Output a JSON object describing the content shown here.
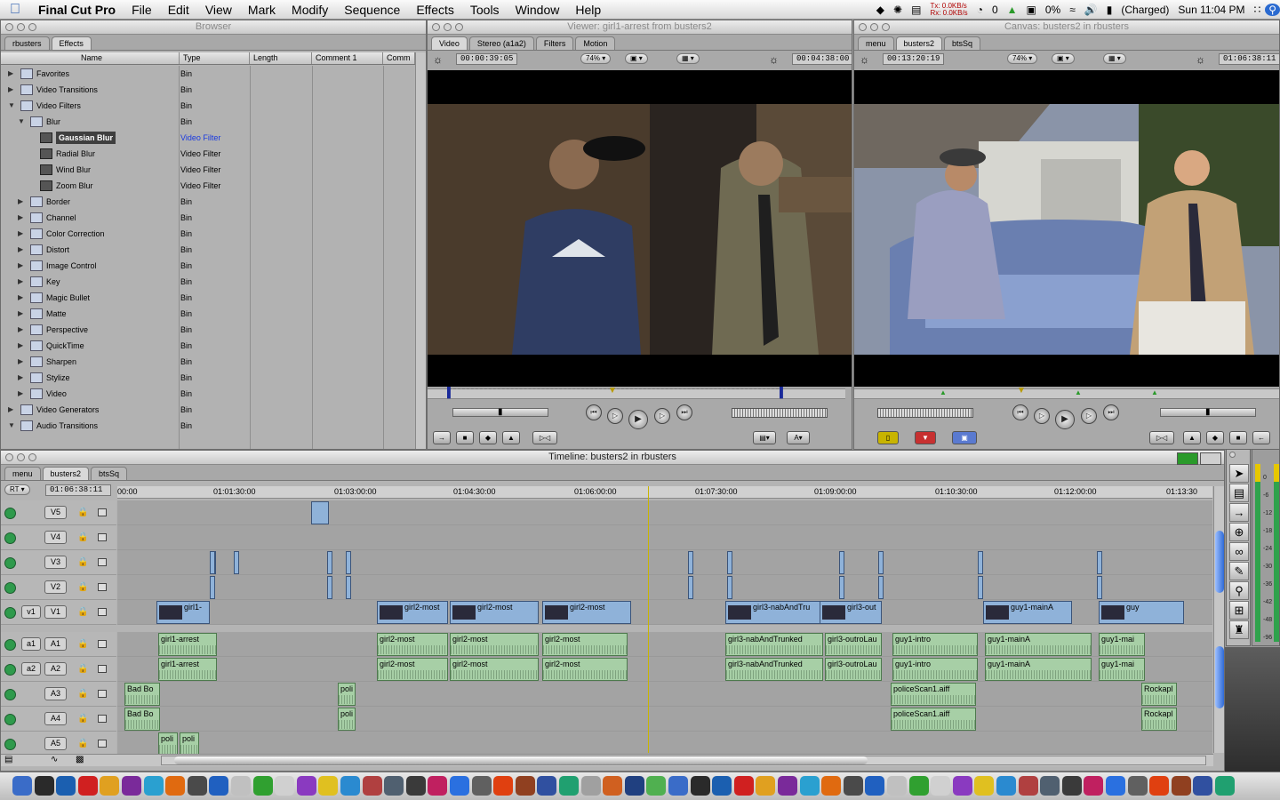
{
  "menubar": {
    "app_name": "Final Cut Pro",
    "items": [
      "File",
      "Edit",
      "View",
      "Mark",
      "Modify",
      "Sequence",
      "Effects",
      "Tools",
      "Window",
      "Help"
    ],
    "net_tx": "Tx: 0.0KB/s",
    "net_rx": "Rx: 0.0KB/s",
    "counter": "0",
    "cpu": "0%",
    "battery": "(Charged)",
    "clock": "Sun 11:04 PM"
  },
  "browser": {
    "title": "Browser",
    "tabs": [
      "rbusters",
      "Effects"
    ],
    "columns": [
      "Name",
      "Type",
      "Length",
      "Comment 1",
      "Comm"
    ],
    "rows": [
      {
        "name": "Favorites",
        "type": "Bin"
      },
      {
        "name": "Video Transitions",
        "type": "Bin"
      },
      {
        "name": "Video Filters",
        "type": "Bin"
      },
      {
        "name": "Blur",
        "type": "Bin"
      },
      {
        "name": "Gaussian Blur",
        "type": "Video Filter"
      },
      {
        "name": "Radial Blur",
        "type": "Video Filter"
      },
      {
        "name": "Wind Blur",
        "type": "Video Filter"
      },
      {
        "name": "Zoom Blur",
        "type": "Video Filter"
      },
      {
        "name": "Border",
        "type": "Bin"
      },
      {
        "name": "Channel",
        "type": "Bin"
      },
      {
        "name": "Color Correction",
        "type": "Bin"
      },
      {
        "name": "Distort",
        "type": "Bin"
      },
      {
        "name": "Image Control",
        "type": "Bin"
      },
      {
        "name": "Key",
        "type": "Bin"
      },
      {
        "name": "Magic Bullet",
        "type": "Bin"
      },
      {
        "name": "Matte",
        "type": "Bin"
      },
      {
        "name": "Perspective",
        "type": "Bin"
      },
      {
        "name": "QuickTime",
        "type": "Bin"
      },
      {
        "name": "Sharpen",
        "type": "Bin"
      },
      {
        "name": "Stylize",
        "type": "Bin"
      },
      {
        "name": "Video",
        "type": "Bin"
      },
      {
        "name": "Video Generators",
        "type": "Bin"
      },
      {
        "name": "Audio Transitions",
        "type": "Bin"
      }
    ]
  },
  "viewer": {
    "title": "Viewer: girl1-arrest from busters2",
    "tabs": [
      "Video",
      "Stereo (a1a2)",
      "Filters",
      "Motion"
    ],
    "timecode": "00:00:39:05",
    "zoom": "74%",
    "duration": "00:04:38:00"
  },
  "canvas": {
    "title": "Canvas: busters2 in rbusters",
    "tabs": [
      "menu",
      "busters2",
      "btsSq"
    ],
    "timecode": "00:13:20:19",
    "zoom": "74%",
    "duration": "01:06:38:11"
  },
  "timeline": {
    "title": "Timeline: busters2 in rbusters",
    "tabs": [
      "menu",
      "busters2",
      "btsSq"
    ],
    "rt": "RT",
    "current_tc": "01:06:38:11",
    "ruler": [
      "00:00",
      "01:01:30:00",
      "01:03:00:00",
      "01:04:30:00",
      "01:06:00:00",
      "01:07:30:00",
      "01:09:00:00",
      "01:10:30:00",
      "01:12:00:00",
      "01:13:30"
    ],
    "tracks": [
      "V5",
      "V4",
      "V3",
      "V2",
      "V1",
      "A1",
      "A2",
      "A3",
      "A4",
      "A5"
    ],
    "src_v": "v1",
    "src_a1": "a1",
    "src_a2": "a2",
    "clips": {
      "v1": [
        "girl1-",
        "girl2-most",
        "girl2-most",
        "girl2-most",
        "girl3-nabAndTru",
        "girl3-out",
        "guy1-mainA",
        "guy"
      ],
      "a1": [
        "girl1-arrest",
        "girl2-most",
        "girl2-most",
        "girl2-most",
        "girl3-nabAndTrunked",
        "girl3-outroLau",
        "guy1-intro",
        "guy1-mainA",
        "guy1-mai"
      ],
      "a2": [
        "girl1-arrest",
        "girl2-most",
        "girl2-most",
        "girl2-most",
        "girl3-nabAndTrunked",
        "girl3-outroLau",
        "guy1-intro",
        "guy1-mainA",
        "guy1-mai"
      ],
      "a3": [
        "Bad Bo",
        "poli",
        "policeScan1.aiff",
        "Rockapl"
      ],
      "a4": [
        "Bad Bo",
        "poli",
        "policeScan1.aiff",
        "Rockapl"
      ],
      "a5": [
        "poli",
        "poli"
      ]
    }
  },
  "meters": [
    "0",
    "-6",
    "-12",
    "-18",
    "-24",
    "-30",
    "-36",
    "-42",
    "-48",
    "-96"
  ],
  "colors": {
    "video_clip": "#8fb2d9",
    "audio_clip": "#a7cfa6",
    "selection": "#3f3f3f",
    "playhead": "#c8b400"
  }
}
